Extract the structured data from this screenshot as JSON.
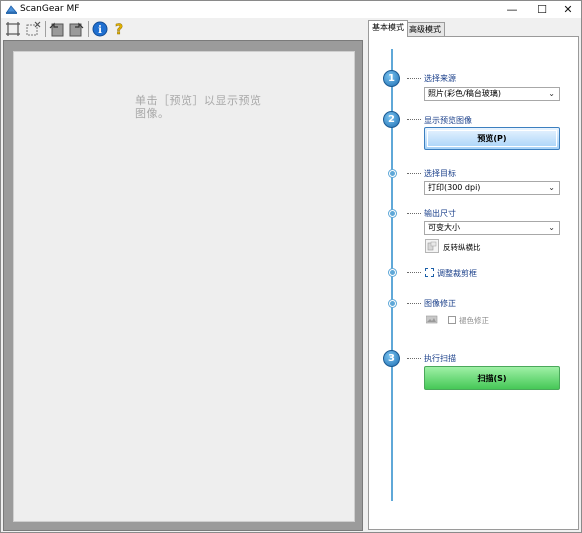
{
  "window": {
    "title": "ScanGear MF",
    "controls": {
      "minimize": "—",
      "maximize": "☐",
      "close": "✕"
    }
  },
  "toolbar": {
    "items": [
      {
        "name": "crop-frame-icon"
      },
      {
        "name": "clear-crop-icon"
      },
      {
        "name": "rotate-left-icon"
      },
      {
        "name": "rotate-right-icon"
      },
      {
        "name": "info-icon",
        "glyph": "i"
      },
      {
        "name": "help-icon",
        "glyph": "?"
      }
    ]
  },
  "preview": {
    "hint": "单击［预览］以显示预览图像。"
  },
  "tabs": [
    {
      "label": "基本模式",
      "active": true
    },
    {
      "label": "高级模式",
      "active": false
    }
  ],
  "steps": {
    "source": {
      "number": "1",
      "label": "选择来源",
      "value": "照片(彩色/稿台玻璃)"
    },
    "preview": {
      "number": "2",
      "label": "显示预览图像",
      "button": "预览(P)"
    },
    "destination": {
      "label": "选择目标",
      "value": "打印(300 dpi)"
    },
    "output": {
      "label": "输出尺寸",
      "value": "可变大小",
      "invert_label": "反转纵横比"
    },
    "crop": {
      "label": "调整裁剪框"
    },
    "correction": {
      "label": "图像修正",
      "fade_label": "褪色修正"
    },
    "scan": {
      "number": "3",
      "label": "执行扫描",
      "button": "扫描(S)"
    }
  },
  "colors": {
    "accent_blue": "#1f6fb3",
    "timeline": "#5fa8d8",
    "scan_green": "#46c857",
    "preview_blue": "#a6d2f8"
  }
}
